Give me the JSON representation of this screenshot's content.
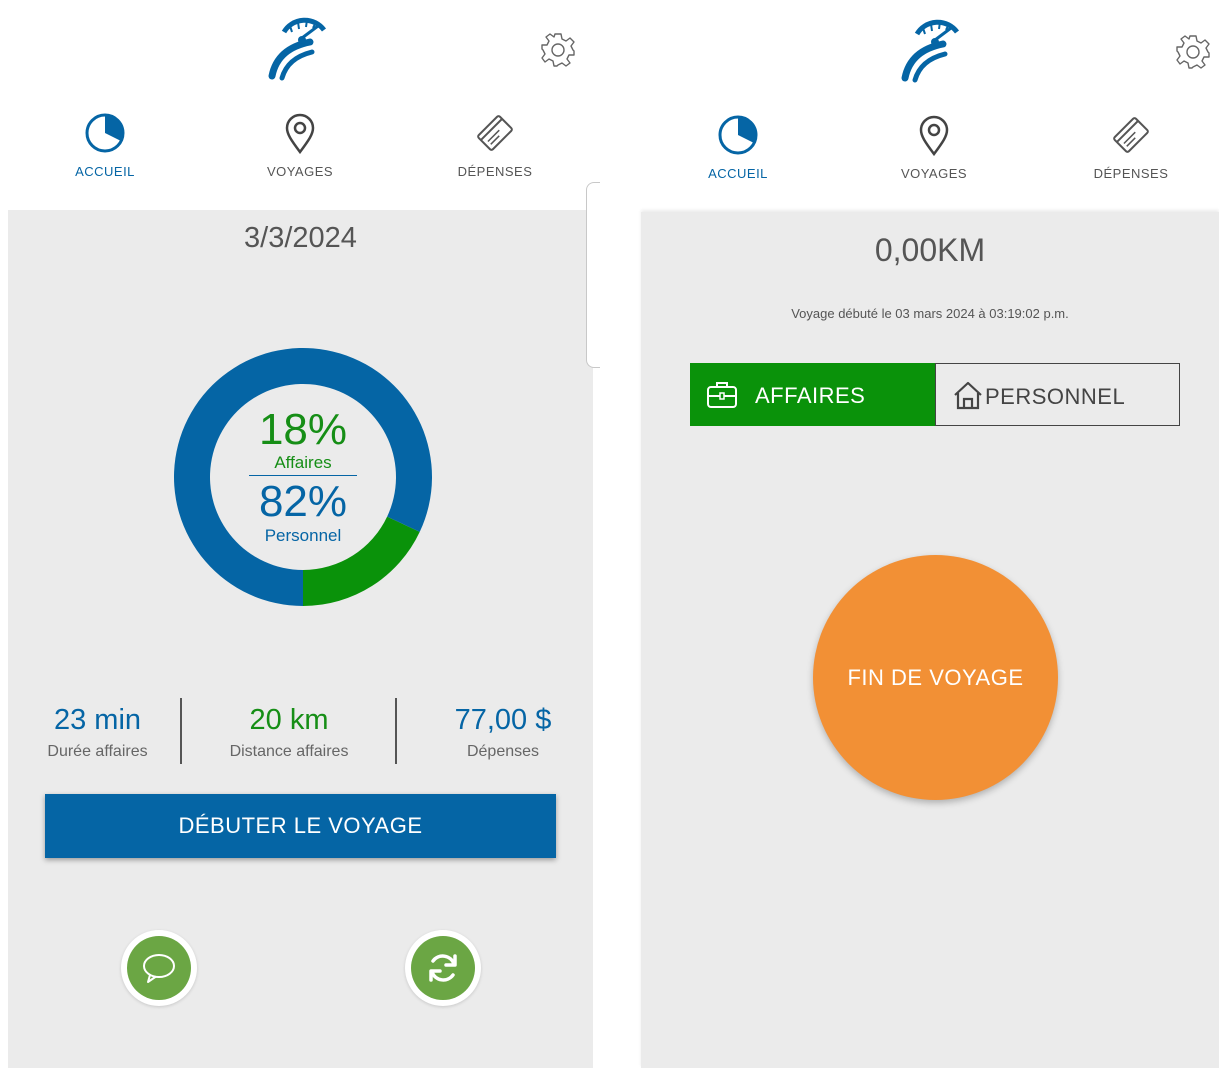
{
  "nav": {
    "home": "ACCUEIL",
    "trips": "VOYAGES",
    "expenses": "DÉPENSES"
  },
  "icons": {
    "logo": "speedometer-road-logo",
    "settings": "gear-icon",
    "home": "pie-chart-icon",
    "trips": "map-pin-icon",
    "expenses": "receipt-card-icon",
    "chat": "chat-bubble-icon",
    "sync": "sync-icon",
    "business": "briefcase-icon",
    "personal": "house-icon"
  },
  "colors": {
    "primary": "#0565a5",
    "business_green": "#168e16",
    "toggle_green": "#0a920a",
    "round_button_green": "#6ba644",
    "end_button_orange": "#f29035",
    "content_bg": "#ebebeb"
  },
  "dashboard": {
    "date": "3/3/2024",
    "business_pct": "18%",
    "business_label": "Affaires",
    "personal_pct": "82%",
    "personal_label": "Personnel",
    "stats": [
      {
        "value": "23 min",
        "label": "Durée affaires"
      },
      {
        "value": "20 km",
        "label": "Distance affaires"
      },
      {
        "value": "77,00 $",
        "label": "Dépenses"
      }
    ],
    "start_button": "DÉBUTER LE VOYAGE"
  },
  "chart_data": {
    "type": "pie",
    "style": "donut",
    "slices": [
      {
        "label": "Affaires",
        "value": 18,
        "color": "#0a920a"
      },
      {
        "label": "Personnel",
        "value": 82,
        "color": "#0565a5"
      }
    ]
  },
  "trip": {
    "distance": "0,00KM",
    "started_text": "Voyage débuté le 03 mars 2024 à 03:19:02 p.m.",
    "business_label": "AFFAIRES",
    "personal_label": "PERSONNEL",
    "selected": "business",
    "end_button": "FIN DE VOYAGE"
  }
}
